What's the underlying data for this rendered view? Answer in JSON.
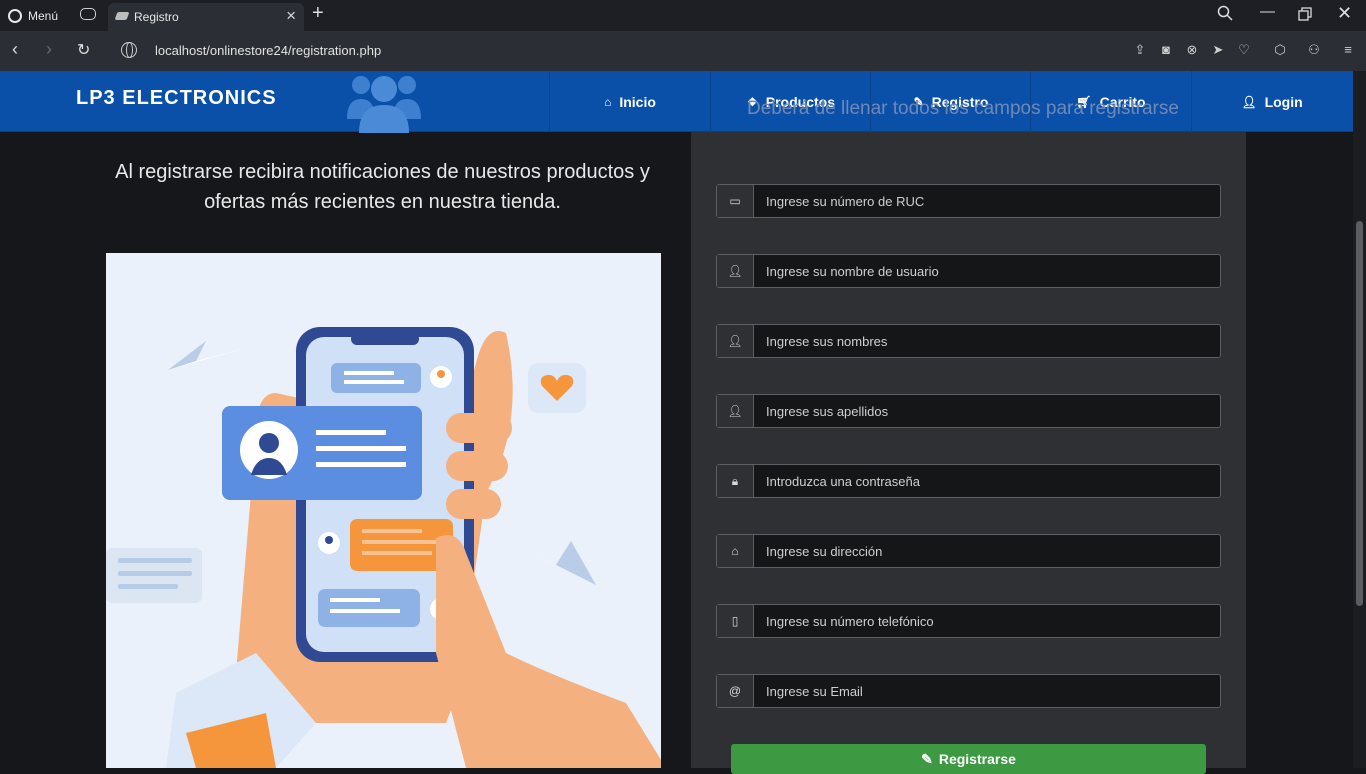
{
  "browser": {
    "menu_label": "Menú",
    "tab_title": "Registro",
    "url": "localhost/onlinestore24/registration.php"
  },
  "navbar": {
    "brand": "LP3 ELECTRONICS",
    "items": [
      {
        "label": "Inicio",
        "icon": "home-icon"
      },
      {
        "label": "Productos",
        "icon": "dropbox-icon"
      },
      {
        "label": "Registro",
        "icon": "edit-icon"
      },
      {
        "label": "Carrito",
        "icon": "cart-icon"
      },
      {
        "label": "Login",
        "icon": "user-icon"
      }
    ]
  },
  "form": {
    "heading": "Deberá de llenar todos los campos para registrarse",
    "fields": [
      {
        "placeholder": "Ingrese su número de RUC",
        "icon": "credit-card-icon"
      },
      {
        "placeholder": "Ingrese su nombre de usuario",
        "icon": "user-icon"
      },
      {
        "placeholder": "Ingrese sus nombres",
        "icon": "user-icon"
      },
      {
        "placeholder": "Ingrese sus apellidos",
        "icon": "user-icon"
      },
      {
        "placeholder": "Introduzca una contraseña",
        "icon": "lock-icon"
      },
      {
        "placeholder": "Ingrese su dirección",
        "icon": "home-icon"
      },
      {
        "placeholder": "Ingrese su número telefónico",
        "icon": "mobile-icon"
      },
      {
        "placeholder": "Ingrese su Email",
        "icon": "at-icon"
      }
    ],
    "submit_label": "Registrarse"
  },
  "tagline": "Al registrarse recibira notificaciones de nuestros productos y ofertas más recientes en nuestra tienda.",
  "colors": {
    "navbar": "#0a50a8",
    "submit": "#3d9a42",
    "panel": "#2f3033"
  }
}
